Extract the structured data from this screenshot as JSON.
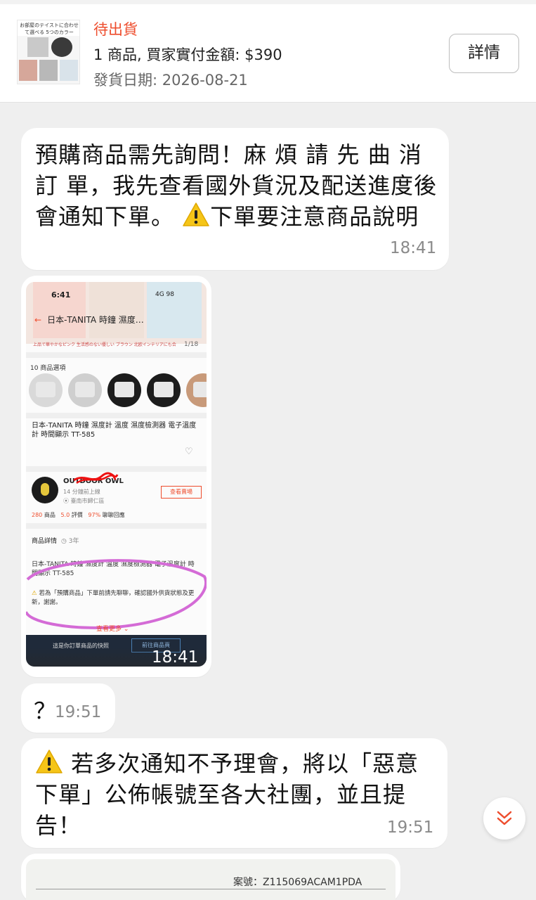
{
  "order": {
    "thumbnail_caption": "お部屋のテイストに合わせて選べる 5つのカラー",
    "status": "待出貨",
    "summary": "1 商品, 買家實付金額: $390",
    "ship_date": "發貨日期: 2026-08-21",
    "details_button": "詳情"
  },
  "messages": [
    {
      "text": "預購商品需先詢問！麻 煩 請 先 曲 消訂 單，我先查看國外貨況及配送進度後會通知下單。",
      "warning_text": "下單要注意商品說明",
      "time": "18:41"
    },
    {
      "type": "image",
      "time": "18:41",
      "shot": {
        "clock": "6:41",
        "signal": "4G 98",
        "title": "日本-TANITA 時鐘 濕度…",
        "page": "1/18",
        "captions": "上品で華やかなピンク   生活感のない優しい ブラウン   北欧インテリアにも合",
        "options_label": "10 商品選項",
        "product_name": "日本-TANITA 時鐘 濕度計 溫度 濕度檢測器 電子溫度計 時間顯示 TT-585",
        "shop_name": "OUTDOOR OWL",
        "online": "14 分鐘前上線",
        "location": "臺南市歸仁區",
        "visit_button": "查看賣場",
        "stats": {
          "products": "280",
          "products_label": "商品",
          "rating": "5.0",
          "rating_label": "評價",
          "response": "97%",
          "response_label": "聊聊回應"
        },
        "detail_heading": "商品詳情",
        "detail_age": "3年",
        "detail_body": "日本-TANITA 時鐘 濕度計 溫度 濕度檢測器 電子溫度計 時間顯示 TT-585",
        "note": "若為「預購商品」下單前請先聊聊，確認國外供貨狀態及更新，謝謝。",
        "see_more": "查看更多",
        "snapshot_text": "這是你訂單商品的快照",
        "snapshot_button": "前往商品頁"
      }
    },
    {
      "text": "？",
      "time": "19:51"
    },
    {
      "text": "若多次通知不予理會，將以「惡意下單」公佈帳號至各大社團，並且提告！",
      "time": "19:51"
    },
    {
      "type": "image",
      "case_number": "案號：Z115069ACAM1PDA"
    }
  ],
  "icons": {
    "warning": "warning-icon",
    "scroll_down": "chevron-double-down-icon"
  },
  "colors": {
    "accent": "#ee4d2d",
    "bubble": "#ffffff",
    "background": "#efefef",
    "warning_yellow": "#f5c518",
    "annotation_purple": "#d46bd6"
  }
}
